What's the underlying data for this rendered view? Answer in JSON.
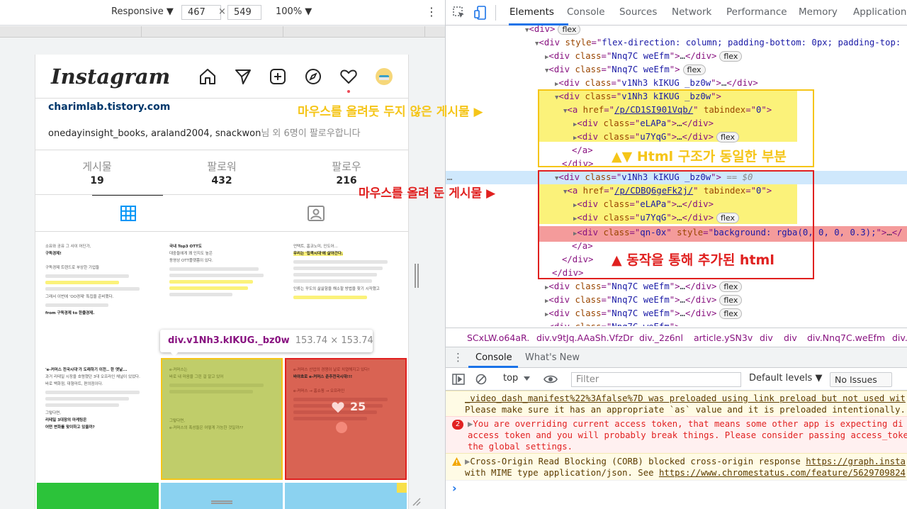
{
  "toolbar": {
    "device": "Responsive ▼",
    "width": "467",
    "times": "×",
    "height": "549",
    "zoom": "100% ▼",
    "menu": "⋮"
  },
  "instagram": {
    "logo": "Instagram",
    "website": "charimlab.tistory.com",
    "followed_by_names": "onedayinsight_books, araland2004, snackwon",
    "followed_by_rest": "님 외 6명이 팔로우합니다",
    "stats": [
      {
        "label": "게시물",
        "value": "19"
      },
      {
        "label": "팔로워",
        "value": "432"
      },
      {
        "label": "팔로우",
        "value": "216"
      }
    ],
    "like_count": "25"
  },
  "posts": {
    "p1": {
      "l1": "소유와 공유 그 사이 어딘가,",
      "l2": "구독경제!",
      "l3": "구독경제 트렌드로 부상한 기업들",
      "l4": "그래서 이번에 'OO경제' 특집을 준비했다.",
      "l5": "from 구독경제 to 한줄경제."
    },
    "p2": {
      "l1": "국내 Top3 OTT도",
      "l2": "대중들에게 꽤 인지도 높은",
      "l3": "동영상 OTT플랫폼이 있다."
    },
    "p3": {
      "l1": "언택트, 홈코노미, 인도어...",
      "l2": "우리는 '집콕시대'에 살아간다.",
      "l3": "인류는 꾸도의 삶삶함을 해소할 방법을 찾기 시작했고"
    },
    "p4": {
      "l1": "'e-커머스 전국시대'가 도래하기 이전.. 한 옛날...",
      "l2": "과거 리테일 시장을 호령했던 3대 오프라인 채널이 있었다.",
      "l3": "바로 백화점, 대형마트, 편의점이다.",
      "l4": "그렇다면,",
      "l5": "리테일 3대장의 마케팅은",
      "l6": "어떤 변화를 맞이하고 있을까?"
    },
    "p5": {
      "l1": "e-커머스는",
      "l2": "바로 내 마음을 그린 걸 알고 있어",
      "l3": "그렇다면,",
      "l4": "e-커머스의 폭성들은 어떻게 가능한 것일까??"
    },
    "p6": {
      "l1": "e-커머스 산업의 경쟁이 날로 치열해지고 있다!",
      "l2": "바야흐로 e-커머스 춘추전국시대!!!",
      "l3": "e-커머스 → 홈쇼핑 → 오프라인"
    }
  },
  "tooltip": {
    "tag": "div.v1Nh3.kIKUG._bz0w",
    "size": "153.74 × 153.74"
  },
  "devtools_tabs": [
    "Elements",
    "Console",
    "Sources",
    "Network",
    "Performance",
    "Memory",
    "Application"
  ],
  "tree": {
    "r0": "<div>",
    "flex": "flex",
    "r1_style": "flex-direction: column; padding-bottom: 0px; padding-top:",
    "nnq": "Nnq7C weEfm",
    "v1nh3": "v1Nh3 kIKUG  _bz0w",
    "href1": "/p/CD1SI901Vqb/",
    "href2": "/p/CDBQ6geFk2j/",
    "tabindex": "0",
    "elapa": "eLAPa",
    "u7yqg": "u7YqG",
    "qn0x": "qn-0x",
    "qn_style": "background: rgba(0, 0, 0, 0.3);",
    "eq": "== $0",
    "ellipsis": "…",
    "dots": "…"
  },
  "breadcrumbs": [
    "SCxLW.o64aR.",
    "div.v9tJq.AAaSh.VfzDr",
    "div._2z6nl",
    "article.ySN3v",
    "div",
    "div",
    "div.Nnq7C.weEfm",
    "div.v"
  ],
  "console": {
    "tabs": [
      "Console",
      "What's New"
    ],
    "context": "top",
    "filter_placeholder": "Filter",
    "levels": "Default levels ▼",
    "issues": "No Issues",
    "m1a": "_video_dash_manifest%22%3Afalse%7D was preloaded using link preload but not used wit",
    "m1b": "Please make sure it has an appropriate `as` value and it is preloaded intentionally.",
    "err_count": "2",
    "m2a": "You are overriding current access token, that means some other app is expecting di",
    "m2b": "access token and you will probably break things. Please consider passing access_toke",
    "m2c": "the global settings.",
    "m3a": "Cross-Origin Read Blocking (CORB) blocked cross-origin response ",
    "m3link": "https://graph.insta",
    "m3b": "with MIME type application/json. See ",
    "m3link2": "https://www.chromestatus.com/feature/5629709824",
    "prompt": "›"
  },
  "annotations": {
    "no_hover": "마우스를 올려둣 두지 않은 게시물 ▶",
    "same": "▲▼ Html 구조가 동일한 부분",
    "hover": "마우스를 올려 둔 게시물 ▶",
    "added": "▲ 동작을 통해 추가된 html"
  },
  "colors": {
    "yellow": "#f5c518",
    "red": "#e0201f",
    "highlight": "#fbf27a"
  }
}
